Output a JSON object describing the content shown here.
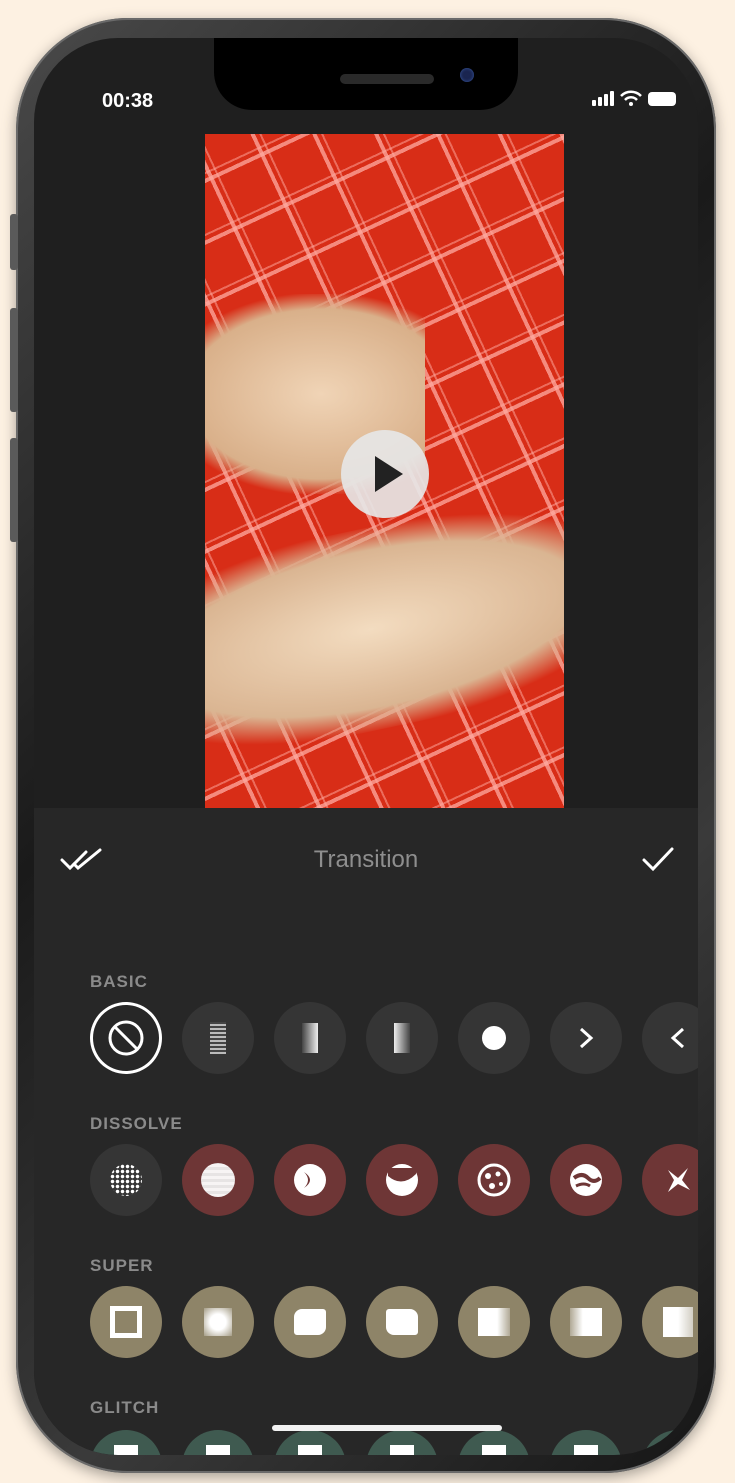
{
  "status_bar": {
    "time": "00:38"
  },
  "editor": {
    "title": "Transition"
  },
  "sections": [
    {
      "id": "basic",
      "label": "BASIC",
      "items": [
        "none-icon",
        "dissolve-gradient-icon",
        "fade-left-icon",
        "fade-right-icon",
        "dot-icon",
        "chevron-right-icon",
        "chevron-left-icon"
      ]
    },
    {
      "id": "dissolve",
      "label": "DISSOLVE",
      "items": [
        "dot-grid-icon",
        "globe-grid-icon",
        "half-moon-icon",
        "wave-circle-icon",
        "dots-circle-icon",
        "swirl-circle-icon",
        "splash-icon"
      ]
    },
    {
      "id": "super",
      "label": "SUPER",
      "items": [
        "square-frame-icon",
        "soft-square-icon",
        "wavy-square-icon",
        "wavy-square-alt-icon",
        "blur-square-icon",
        "blur-square-alt-icon",
        "half-square-icon"
      ]
    },
    {
      "id": "glitch",
      "label": "GLITCH",
      "items": [
        "glitch-1-icon",
        "glitch-2-icon",
        "glitch-3-icon",
        "glitch-4-icon",
        "glitch-5-icon",
        "glitch-6-icon",
        "glitch-7-icon"
      ]
    }
  ],
  "colors": {
    "basic_tile": "#353535",
    "dissolve_tile": "#6e3636",
    "super_tile": "#8e8468",
    "glitch_tile": "#3f5a50",
    "video_background": "#d82d17"
  }
}
